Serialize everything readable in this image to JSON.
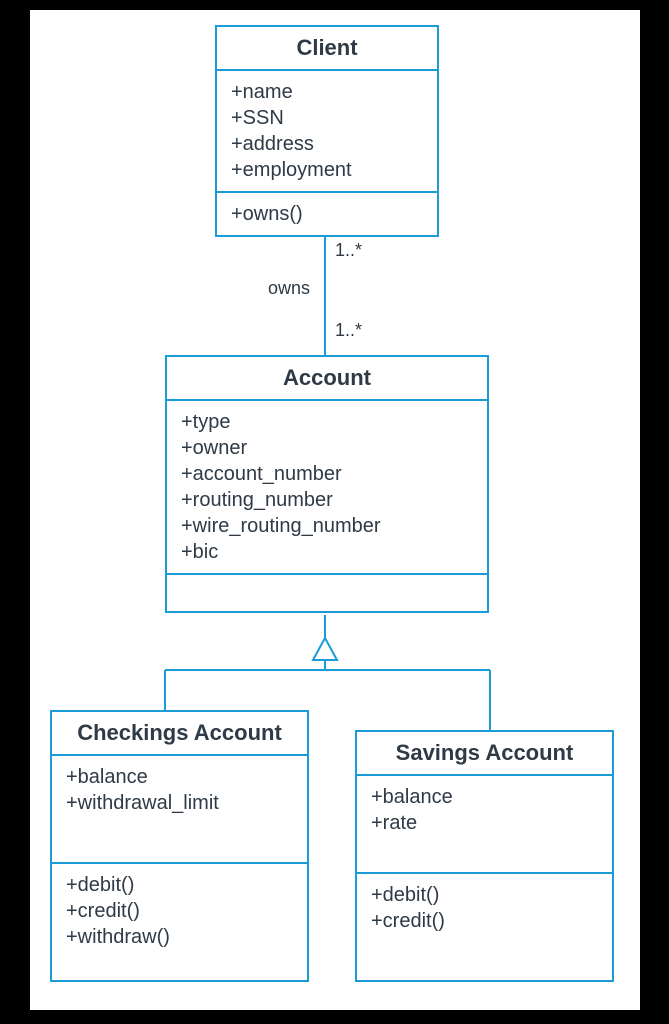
{
  "classes": {
    "client": {
      "title": "Client",
      "attrs": [
        "+name",
        "+SSN",
        "+address",
        "+employment"
      ],
      "methods": [
        "+owns()"
      ]
    },
    "account": {
      "title": "Account",
      "attrs": [
        "+type",
        "+owner",
        "+account_number",
        "+routing_number",
        "+wire_routing_number",
        "+bic"
      ],
      "methods": []
    },
    "checkings": {
      "title": "Checkings Account",
      "attrs": [
        "+balance",
        "+withdrawal_limit"
      ],
      "methods": [
        "+debit()",
        "+credit()",
        "+withdraw()"
      ]
    },
    "savings": {
      "title": "Savings Account",
      "attrs": [
        "+balance",
        "+rate"
      ],
      "methods": [
        "+debit()",
        "+credit()"
      ]
    }
  },
  "relations": {
    "owns_label": "owns",
    "mult_top": "1..*",
    "mult_bottom": "1..*"
  }
}
